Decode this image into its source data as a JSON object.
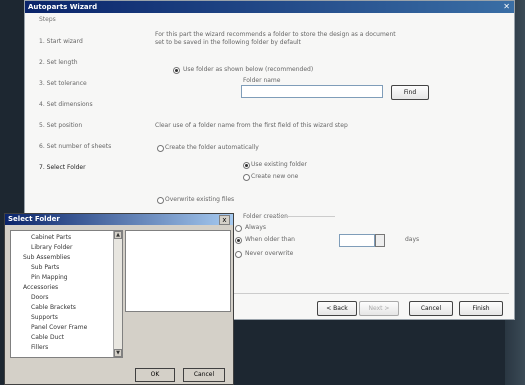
{
  "wizard": {
    "title": "Autoparts Wizard",
    "close_glyph": "✕",
    "steps_header": "Steps",
    "steps": [
      "1. Start wizard",
      "2. Set length",
      "3. Set tolerance",
      "4. Set dimensions",
      "5. Set position",
      "6. Set number of sheets",
      "7. Select Folder"
    ],
    "intro_line1": "For this part the wizard recommends a folder to store the design as a document",
    "intro_line2": "set to be saved in the following folder by default",
    "use_folder_label": "Use folder as shown below (recommended)",
    "folder_name_label": "Folder name",
    "folder_value": "",
    "find_button": "Find",
    "note_line": "Clear use of a folder name from the first field of this wizard step",
    "create_option": "Create the folder automatically",
    "suboption1": "Use existing folder",
    "suboption2": "Create new one",
    "overwrite_label": "Overwrite existing files",
    "folder_policy_label": "Folder creation",
    "radio_always": "Always",
    "radio_newer": "When older than",
    "radio_never": "Never overwrite",
    "days_value": "",
    "days_unit": "days",
    "back_button": "< Back",
    "next_button": "Next >",
    "cancel_button": "Cancel",
    "finish_button": "Finish"
  },
  "select_folder": {
    "title": "Select Folder",
    "close_glyph": "x",
    "tree": [
      {
        "label": "Cabinet Parts",
        "indent": 2
      },
      {
        "label": "Library Folder",
        "indent": 2
      },
      {
        "label": "Sub Assemblies",
        "indent": 1
      },
      {
        "label": "Sub Parts",
        "indent": 2
      },
      {
        "label": "Pin Mapping",
        "indent": 2
      },
      {
        "label": "Accessories",
        "indent": 1
      },
      {
        "label": "Doors",
        "indent": 2
      },
      {
        "label": "Cable Brackets",
        "indent": 2
      },
      {
        "label": "Supports",
        "indent": 2
      },
      {
        "label": "Panel Cover Frame",
        "indent": 2
      },
      {
        "label": "Cable Duct",
        "indent": 2
      },
      {
        "label": "Fillers",
        "indent": 2
      }
    ],
    "scroll_up_glyph": "▲",
    "scroll_down_glyph": "▼",
    "ok_button": "OK",
    "cancel_button": "Cancel"
  }
}
